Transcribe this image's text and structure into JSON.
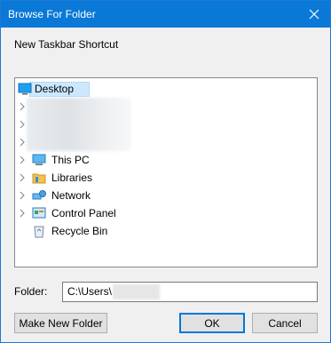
{
  "window": {
    "title": "Browse For Folder",
    "accent": "#0a78d7"
  },
  "dialog": {
    "prompt": "New Taskbar Shortcut"
  },
  "tree": {
    "items": [
      {
        "label": "Desktop",
        "icon": "desktop-icon",
        "selected": true
      },
      {
        "label": "This PC",
        "icon": "this-pc-icon"
      },
      {
        "label": "Libraries",
        "icon": "libraries-icon"
      },
      {
        "label": "Network",
        "icon": "network-icon"
      },
      {
        "label": "Control Panel",
        "icon": "control-panel-icon"
      },
      {
        "label": "Recycle Bin",
        "icon": "recycle-bin-icon"
      }
    ]
  },
  "folder": {
    "label": "Folder:",
    "value": "C:\\Users\\"
  },
  "buttons": {
    "new_folder": "Make New Folder",
    "ok": "OK",
    "cancel": "Cancel"
  }
}
